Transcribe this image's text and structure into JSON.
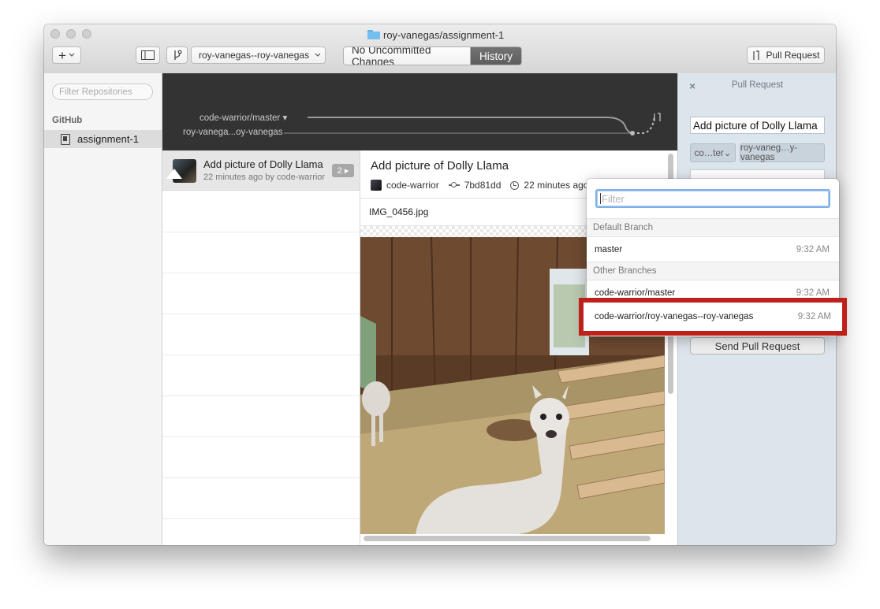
{
  "window": {
    "title": "roy-vanegas/assignment-1"
  },
  "toolbar": {
    "add_label": "+",
    "branch_selector": "roy-vanegas--roy-vanegas",
    "seg_changes": "No Uncommitted Changes",
    "seg_history": "History",
    "pull_request": "Pull Request"
  },
  "sidebar": {
    "filter_placeholder": "Filter Repositories",
    "section": "GitHub",
    "repo": "assignment-1"
  },
  "graph": {
    "branch_a": "code-warrior/master ▾",
    "branch_b": "roy-vanega...oy-vanegas"
  },
  "commits": [
    {
      "title": "Add picture of Dolly Llama",
      "meta": "22 minutes ago by code-warrior",
      "files": "2 ▸"
    }
  ],
  "detail": {
    "title": "Add picture of Dolly Llama",
    "author": "code-warrior",
    "sha": "7bd81dd",
    "time": "22 minutes ago",
    "file": "IMG_0456.jpg"
  },
  "pr": {
    "header": "Pull Request",
    "close": "×",
    "title_value": "Add picture of Dolly Llama",
    "base_branch": "co…ter⌄",
    "head_branch": "roy-vaneg…y-vanegas",
    "send": "Send Pull Request"
  },
  "popover": {
    "filter_placeholder": "Filter",
    "default_section": "Default Branch",
    "other_section": "Other Branches",
    "default_branches": [
      {
        "name": "master",
        "time": "9:32 AM"
      }
    ],
    "other_branches": [
      {
        "name": "code-warrior/master",
        "time": "9:32 AM"
      },
      {
        "name": "code-warrior/roy-vanegas--roy-vanegas",
        "time": "9:32 AM"
      }
    ]
  },
  "colors": {
    "highlight": "#c0201a",
    "graph_bg": "#333333",
    "pr_panel": "#dde5ec"
  }
}
